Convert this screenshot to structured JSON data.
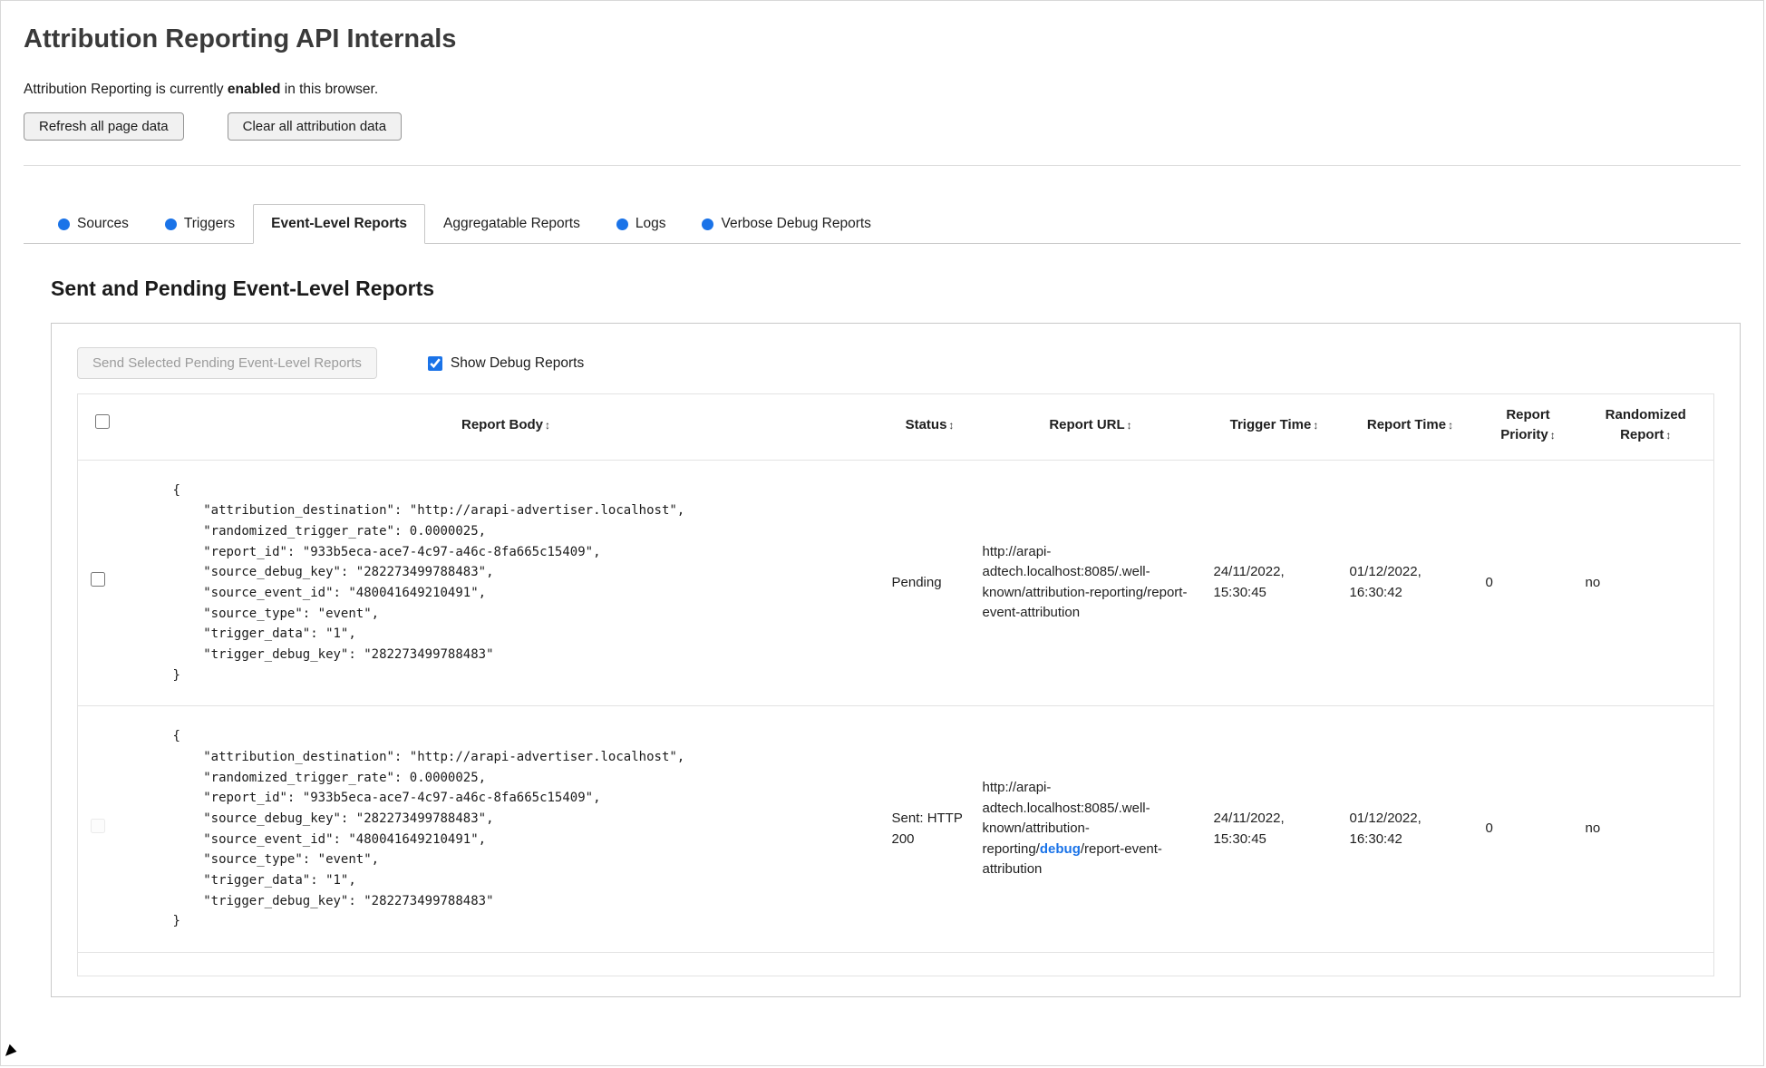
{
  "page": {
    "title": "Attribution Reporting API Internals",
    "status_prefix": "Attribution Reporting is currently ",
    "status_bold": "enabled",
    "status_suffix": " in this browser.",
    "refresh_button_label": "Refresh all page data",
    "clear_button_label": "Clear all attribution data"
  },
  "colors": {
    "accent_blue": "#1a73e8"
  },
  "icons": {
    "sort": "↕",
    "tab_dot": "●"
  },
  "tabs": [
    {
      "label": "Sources"
    },
    {
      "label": "Triggers"
    },
    {
      "label": "Event-Level Reports"
    },
    {
      "label": "Aggregatable Reports"
    },
    {
      "label": "Logs"
    },
    {
      "label": "Verbose Debug Reports"
    }
  ],
  "section": {
    "heading": "Sent and Pending Event-Level Reports"
  },
  "controls": {
    "send_button_label": "Send Selected Pending Event-Level Reports",
    "send_disabled": "disabled",
    "show_debug_label": "Show Debug Reports",
    "show_debug_checked": "checked",
    "row2_checkbox_disabled": "disabled"
  },
  "table": {
    "headers": {
      "body": "Report Body",
      "status": "Status",
      "url": "Report URL",
      "trigger_time": "Trigger Time",
      "report_time": "Report Time",
      "priority": "Report Priority",
      "randomized": "Randomized Report"
    },
    "rows": [
      {
        "report_body": "{\n    \"attribution_destination\": \"http://arapi-advertiser.localhost\",\n    \"randomized_trigger_rate\": 0.0000025,\n    \"report_id\": \"933b5eca-ace7-4c97-a46c-8fa665c15409\",\n    \"source_debug_key\": \"282273499788483\",\n    \"source_event_id\": \"480041649210491\",\n    \"source_type\": \"event\",\n    \"trigger_data\": \"1\",\n    \"trigger_debug_key\": \"282273499788483\"\n}",
        "status": "Pending",
        "url_prefix": "http://arapi-adtech.localhost:8085/.well-known/attribution-reporting/report-event-attribution",
        "url_debug": "",
        "url_suffix": "",
        "trigger_time": "24/11/2022, 15:30:45",
        "report_time": "01/12/2022, 16:30:42",
        "priority": "0",
        "randomized": "no"
      },
      {
        "report_body": "{\n    \"attribution_destination\": \"http://arapi-advertiser.localhost\",\n    \"randomized_trigger_rate\": 0.0000025,\n    \"report_id\": \"933b5eca-ace7-4c97-a46c-8fa665c15409\",\n    \"source_debug_key\": \"282273499788483\",\n    \"source_event_id\": \"480041649210491\",\n    \"source_type\": \"event\",\n    \"trigger_data\": \"1\",\n    \"trigger_debug_key\": \"282273499788483\"\n}",
        "status": "Sent: HTTP 200",
        "url_prefix": "http://arapi-adtech.localhost:8085/.well-known/attribution-reporting/",
        "url_debug": "debug",
        "url_suffix": "/report-event-attribution",
        "trigger_time": "24/11/2022, 15:30:45",
        "report_time": "01/12/2022, 16:30:42",
        "priority": "0",
        "randomized": "no"
      }
    ]
  }
}
